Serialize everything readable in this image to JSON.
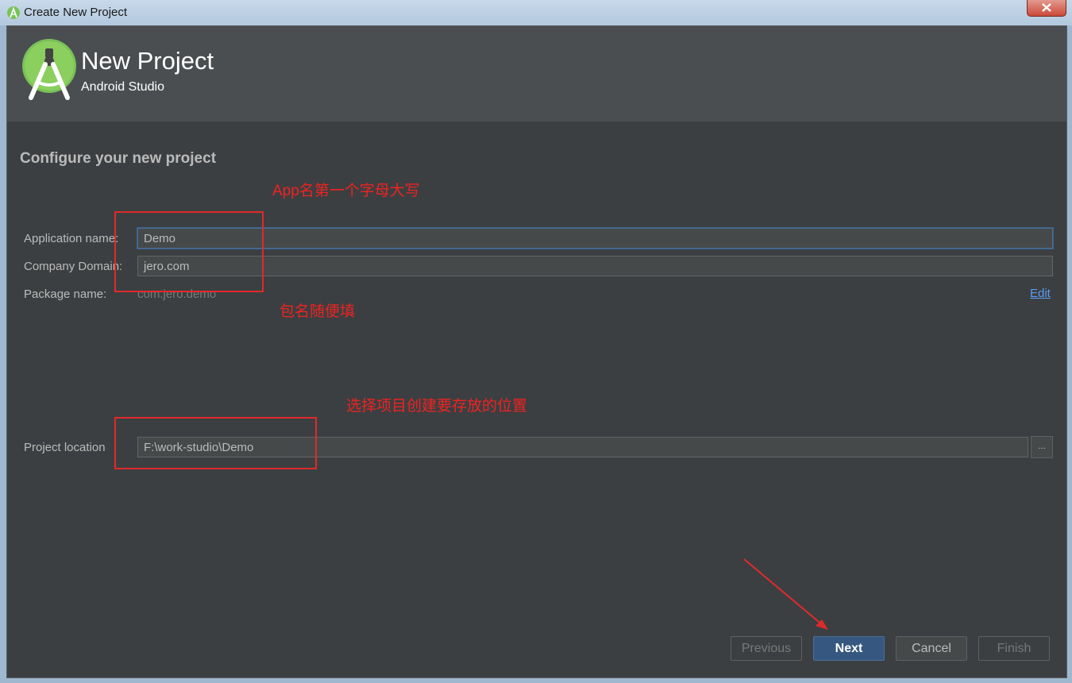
{
  "window": {
    "title": "Create New Project",
    "close_icon": "close-icon"
  },
  "header": {
    "title": "New Project",
    "subtitle": "Android Studio",
    "logo_icon": "android-studio-logo"
  },
  "section_title": "Configure your new project",
  "form": {
    "app_name_label": "Application name:",
    "app_name_value": "Demo",
    "company_domain_label": "Company Domain:",
    "company_domain_value": "jero.com",
    "package_name_label": "Package name:",
    "package_name_value": "com.jero.demo",
    "edit_link": "Edit",
    "project_location_label": "Project location",
    "project_location_value": "F:\\work-studio\\Demo",
    "browse_label": "..."
  },
  "buttons": {
    "previous": "Previous",
    "next": "Next",
    "cancel": "Cancel",
    "finish": "Finish"
  },
  "annotations": {
    "app_name_note": "App名第一个字母大写",
    "package_note": "包名随便填",
    "location_note": "选择项目创建要存放的位置",
    "color": "#ee2222"
  },
  "colors": {
    "dialog_bg": "#3c3f41",
    "header_bg": "#4b4e50",
    "accent": "#365880",
    "link": "#589df6"
  }
}
